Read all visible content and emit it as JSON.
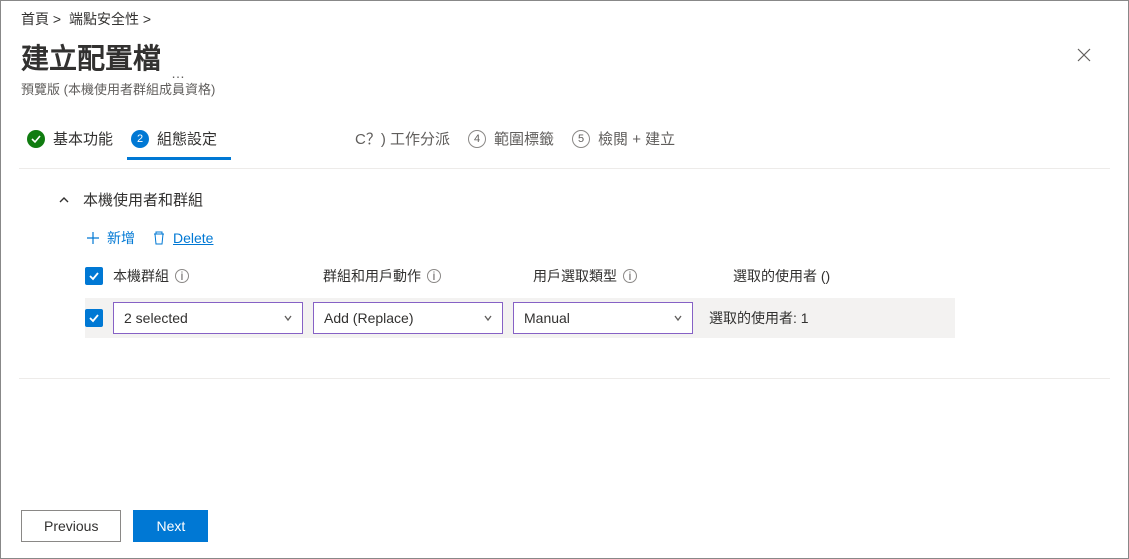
{
  "breadcrumb": {
    "home": "首頁 >",
    "endpoint": "端點安全性 >"
  },
  "header": {
    "title": "建立配置檔",
    "subtitle": "預覽版 (本機使用者群組成員資格)",
    "dots": "…"
  },
  "stepper": {
    "s1": "基本功能",
    "s2": "組態設定",
    "s3": "C？) 工作分派",
    "s4": "範圍標籤",
    "s4_n": "4",
    "s5": "檢閱 + 建立",
    "s5_n": "5"
  },
  "section": {
    "title": "本機使用者和群組",
    "add": "新增",
    "delete": "Delete"
  },
  "columns": {
    "c1": "本機群組",
    "c2": "群組和用戶動作",
    "c3": "用戶選取類型",
    "c4": "選取的使用者 ()"
  },
  "row": {
    "sel1": "2 selected",
    "sel2": "Add (Replace)",
    "sel3": "Manual",
    "result": "選取的使用者: 1"
  },
  "footer": {
    "prev": "Previous",
    "next": "Next"
  }
}
